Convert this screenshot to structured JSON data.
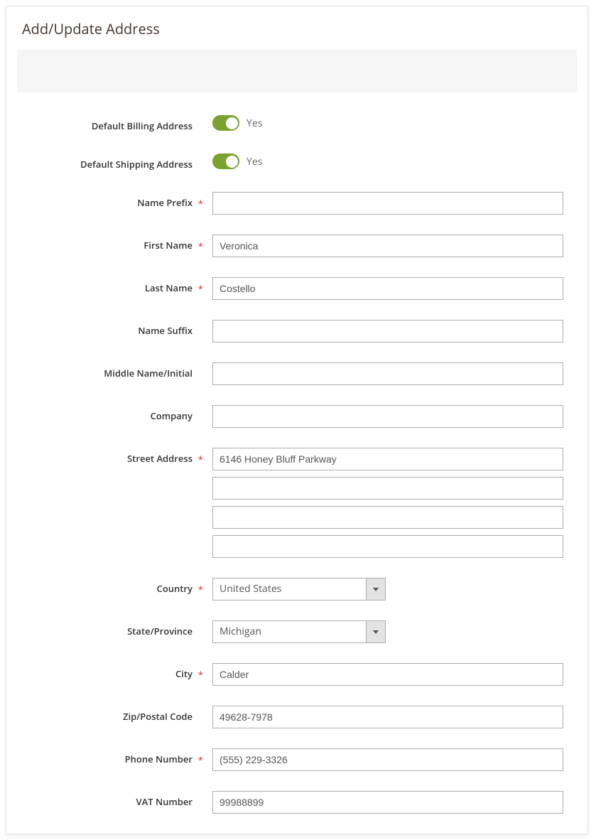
{
  "title": "Add/Update Address",
  "toggles": {
    "default_billing": {
      "label": "Default Billing Address",
      "value_label": "Yes"
    },
    "default_shipping": {
      "label": "Default Shipping Address",
      "value_label": "Yes"
    }
  },
  "fields": {
    "name_prefix": {
      "label": "Name Prefix",
      "value": ""
    },
    "first_name": {
      "label": "First Name",
      "value": "Veronica"
    },
    "last_name": {
      "label": "Last Name",
      "value": "Costello"
    },
    "name_suffix": {
      "label": "Name Suffix",
      "value": ""
    },
    "middle_name": {
      "label": "Middle Name/Initial",
      "value": ""
    },
    "company": {
      "label": "Company",
      "value": ""
    },
    "street": {
      "label": "Street Address",
      "lines": [
        "6146 Honey Bluff Parkway",
        "",
        "",
        ""
      ]
    },
    "country": {
      "label": "Country",
      "value": "United States"
    },
    "state": {
      "label": "State/Province",
      "value": "Michigan"
    },
    "city": {
      "label": "City",
      "value": "Calder"
    },
    "zip": {
      "label": "Zip/Postal Code",
      "value": "49628-7978"
    },
    "phone": {
      "label": "Phone Number",
      "value": "(555) 229-3326"
    },
    "vat": {
      "label": "VAT Number",
      "value": "99988899"
    }
  }
}
